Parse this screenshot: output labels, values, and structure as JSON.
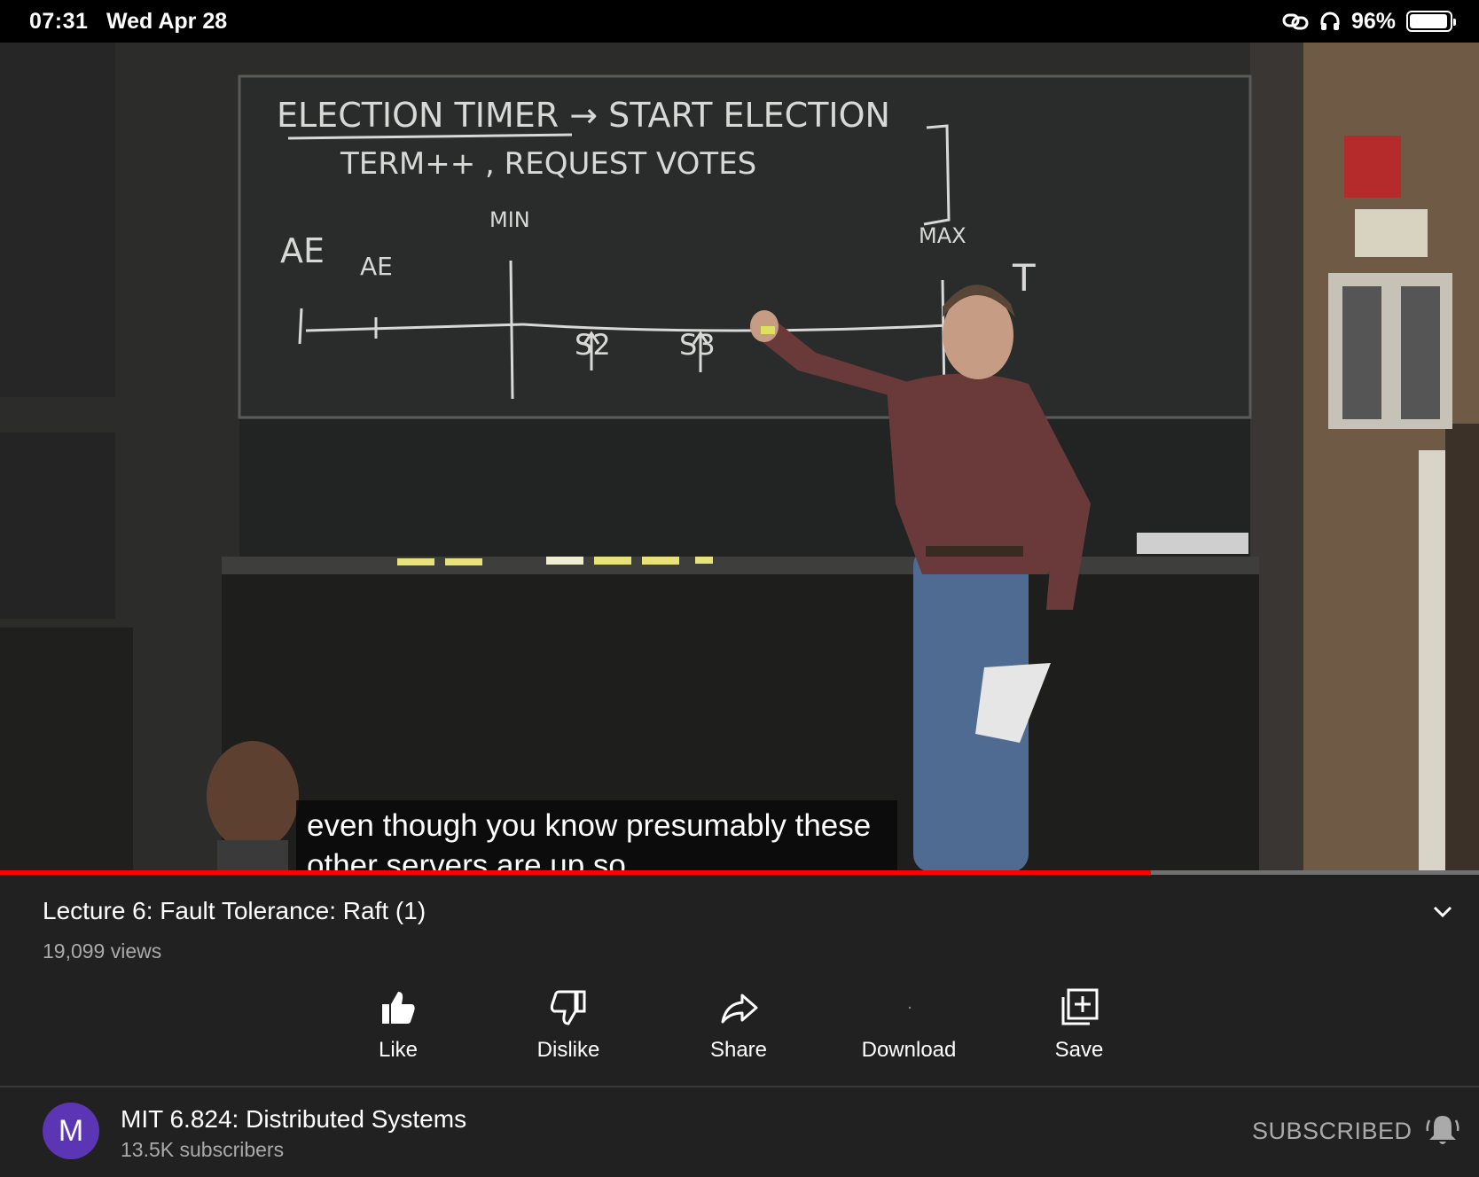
{
  "status_bar": {
    "time": "07:31",
    "date": "Wed Apr 28",
    "battery_percent_label": "96%",
    "battery_level": 0.96,
    "icons": [
      "link-icon",
      "headphones-icon",
      "battery-icon"
    ]
  },
  "video": {
    "caption_lines": [
      "even though you know presumably these",
      "other servers are up so"
    ],
    "progress": 0.778,
    "board": {
      "line1": "ELECTION TIMER → START ELECTION",
      "line2": "TERM++ , REQUEST VOTES",
      "ae_left": "AE",
      "ae_mid": "AE",
      "min": "MIN",
      "max": "MAX",
      "t": "T",
      "s2": "S2",
      "s3": "S3"
    }
  },
  "info": {
    "title": "Lecture 6: Fault Tolerance: Raft (1)",
    "views": "19,099 views"
  },
  "actions": {
    "like": "Like",
    "dislike": "Dislike",
    "share": "Share",
    "download": "Download",
    "save": "Save"
  },
  "channel": {
    "avatar_letter": "M",
    "avatar_color": "#5c35b4",
    "name": "MIT 6.824: Distributed Systems",
    "subscribers": "13.5K subscribers",
    "subscribe_state": "SUBSCRIBED"
  },
  "colors": {
    "progress": "#ff0000",
    "background": "#212121"
  }
}
